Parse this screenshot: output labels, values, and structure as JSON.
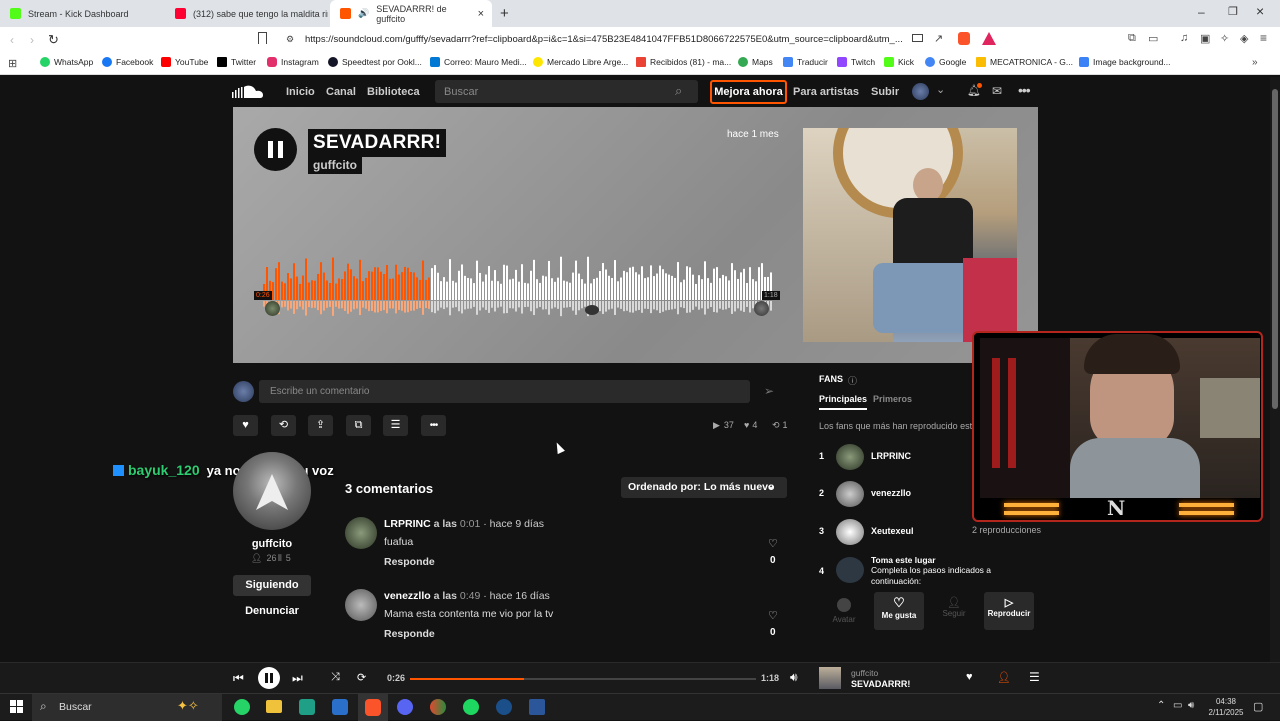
{
  "browser": {
    "tabs": [
      {
        "title": "Stream - Kick Dashboard",
        "color": "#53fc18"
      },
      {
        "title": "(312) sabe que tengo la maldita rima",
        "color": "#ff0033"
      },
      {
        "title": "SEVADARRR! de guffcito",
        "color": "#ff5500"
      }
    ],
    "url": "https://soundcloud.com/gufffy/sevadarrr?ref=clipboard&p=i&c=1&si=475B23E4841047FFB51D8066722575E0&utm_source=clipboard&utm_...",
    "bookmarks": [
      {
        "label": "WhatsApp",
        "color": "#25d366"
      },
      {
        "label": "Facebook",
        "color": "#1877f2"
      },
      {
        "label": "YouTube",
        "color": "#ff0000"
      },
      {
        "label": "Twitter",
        "color": "#000000"
      },
      {
        "label": "Instagram",
        "color": "#e1306c"
      },
      {
        "label": "Speedtest por Ookl...",
        "color": "#141526"
      },
      {
        "label": "Correo: Mauro Medi...",
        "color": "#0078d4"
      },
      {
        "label": "Mercado Libre Arge...",
        "color": "#ffe600"
      },
      {
        "label": "Recibidos (81) - ma...",
        "color": "#ea4335"
      },
      {
        "label": "Maps",
        "color": "#34a853"
      },
      {
        "label": "Traducir",
        "color": "#4285f4"
      },
      {
        "label": "Twitch",
        "color": "#9146ff"
      },
      {
        "label": "Kick",
        "color": "#53fc18"
      },
      {
        "label": "Google",
        "color": "#4285f4"
      },
      {
        "label": "MECATRONICA - G...",
        "color": "#fbbc04"
      },
      {
        "label": "Image background...",
        "color": "#3b82f6"
      }
    ]
  },
  "sc_header": {
    "nav": [
      "Inicio",
      "Canal",
      "Biblioteca"
    ],
    "search_placeholder": "Buscar",
    "upgrade": "Mejora ahora",
    "for_artists": "Para artistas",
    "upload": "Subir"
  },
  "track": {
    "title": "SEVADARRR!",
    "artist": "guffcito",
    "posted": "hace 1 mes",
    "current_time": "0:26",
    "duration": "1:18",
    "progress": 0.33
  },
  "comment_input": {
    "placeholder": "Escribe un comentario"
  },
  "stats": {
    "plays": "37",
    "likes": "4",
    "reposts": "1"
  },
  "overlay_chat": {
    "user": "bayuk_120",
    "message": "ya no soporto tu voz"
  },
  "artist_panel": {
    "name": "guffcito",
    "followers": "26",
    "tracks": "5",
    "following_btn": "Siguiendo",
    "report": "Denunciar"
  },
  "comments": {
    "count_label": "3 comentarios",
    "sort_label": "Ordenado por: Lo más nuevo",
    "items": [
      {
        "user": "LRPRINC",
        "at": "a las",
        "time": "0:01",
        "ago": "· hace 9 días",
        "text": "fuafua",
        "reply": "Responde",
        "likes": "0"
      },
      {
        "user": "venezzllo",
        "at": "a las",
        "time": "0:49",
        "ago": "· hace 16 días",
        "text": "Mama esta contenta me vio por la tv",
        "reply": "Responde",
        "likes": "0"
      }
    ]
  },
  "fans": {
    "title": "FANS",
    "tabs": [
      "Principales",
      "Primeros"
    ],
    "subtitle": "Los fans que más han reproducido esta",
    "list": [
      {
        "rank": "1",
        "name": "LRPRINC",
        "extra": ""
      },
      {
        "rank": "2",
        "name": "venezzllo",
        "extra": ""
      },
      {
        "rank": "3",
        "name": "Xeutexeul",
        "extra": "2 reproducciones"
      }
    ],
    "cta": {
      "rank": "4",
      "title": "Toma este lugar",
      "text": "Completa los pasos indicados a continuación:"
    },
    "steps": [
      "Avatar",
      "Me gusta",
      "Seguir",
      "Reproducir"
    ]
  },
  "player": {
    "current": "0:26",
    "total": "1:18",
    "artist": "guffcito",
    "title": "SEVADARRR!",
    "progress": 0.33
  },
  "taskbar": {
    "search": "Buscar",
    "time": "04:38",
    "date": "2/11/2025"
  }
}
